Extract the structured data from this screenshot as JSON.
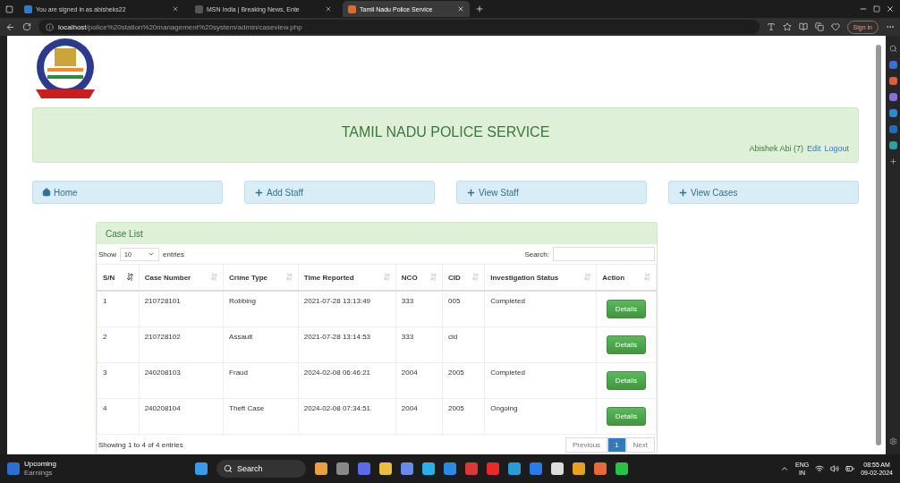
{
  "browser": {
    "tabs": [
      {
        "title": "You are signed in as abisheks22",
        "selected": false
      },
      {
        "title": "MSN India | Breaking News, Ente",
        "selected": false
      },
      {
        "title": "Tamil Nadu Police Service",
        "selected": true
      }
    ],
    "url_host": "localhost",
    "url_path": "/police%20station%20management%20system/admin/caseview.php",
    "sign_in": "Sign in"
  },
  "header": {
    "title": "TAMIL NADU POLICE SERVICE",
    "user": "Abishek Abi (7)",
    "edit": "Edit",
    "logout": "Logout"
  },
  "nav": [
    {
      "label": "Home",
      "kind": "home"
    },
    {
      "label": "Add Staff",
      "kind": "add"
    },
    {
      "label": "View Staff",
      "kind": "add"
    },
    {
      "label": "View Cases",
      "kind": "add"
    }
  ],
  "case_list": {
    "title": "Case List",
    "show_label": "Show",
    "entries_value": "10",
    "entries_label": "entries",
    "search_label": "Search:",
    "columns": [
      {
        "label": "S/N",
        "sorted": true
      },
      {
        "label": "Case Number",
        "sorted": false
      },
      {
        "label": "Crime Type",
        "sorted": false
      },
      {
        "label": "Time Reported",
        "sorted": false
      },
      {
        "label": "NCO",
        "sorted": false
      },
      {
        "label": "CID",
        "sorted": false
      },
      {
        "label": "Investigation Status",
        "sorted": false
      },
      {
        "label": "Action",
        "sorted": false
      }
    ],
    "rows": [
      [
        "1",
        "210728101",
        "Robbing",
        "2021-07-28 13:13:49",
        "333",
        "005",
        "Completed"
      ],
      [
        "2",
        "210728102",
        "Assault",
        "2021-07-28 13:14:53",
        "333",
        "cid",
        ""
      ],
      [
        "3",
        "240208103",
        "Fraud",
        "2024-02-08 06:46:21",
        "2004",
        "2005",
        "Completed"
      ],
      [
        "4",
        "240208104",
        "Theft Case",
        "2024-02-08 07:34:51",
        "2004",
        "2005",
        "Ongoing"
      ]
    ],
    "actions": [
      "Details",
      "Details",
      "Details",
      "Details"
    ],
    "info": "Showing 1 to 4 of 4 entries",
    "pages": [
      {
        "label": "Previous",
        "selected": false
      },
      {
        "label": "1",
        "selected": true
      },
      {
        "label": "Next",
        "selected": false
      }
    ]
  },
  "taskbar": {
    "widget_title": "Upcoming",
    "widget_sub": "Earnings",
    "search": "Search",
    "lang": "ENG",
    "region": "IN",
    "time": "08:55 AM",
    "date": "09-02-2024"
  }
}
